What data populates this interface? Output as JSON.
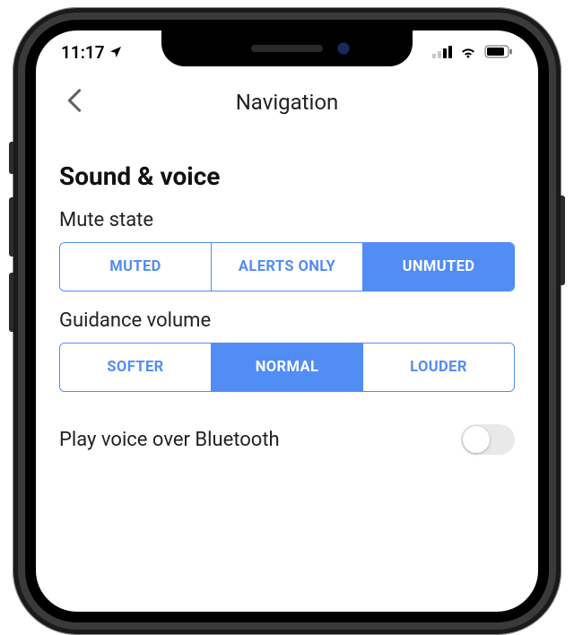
{
  "status": {
    "time": "11:17",
    "location_services": true
  },
  "header": {
    "title": "Navigation"
  },
  "section": {
    "title": "Sound & voice"
  },
  "mute_state": {
    "label": "Mute state",
    "options": [
      "MUTED",
      "ALERTS ONLY",
      "UNMUTED"
    ],
    "selected": "UNMUTED"
  },
  "guidance_volume": {
    "label": "Guidance volume",
    "options": [
      "SOFTER",
      "NORMAL",
      "LOUDER"
    ],
    "selected": "NORMAL"
  },
  "bluetooth_row": {
    "label": "Play voice over Bluetooth",
    "enabled": false
  },
  "colors": {
    "accent": "#528cf5"
  }
}
